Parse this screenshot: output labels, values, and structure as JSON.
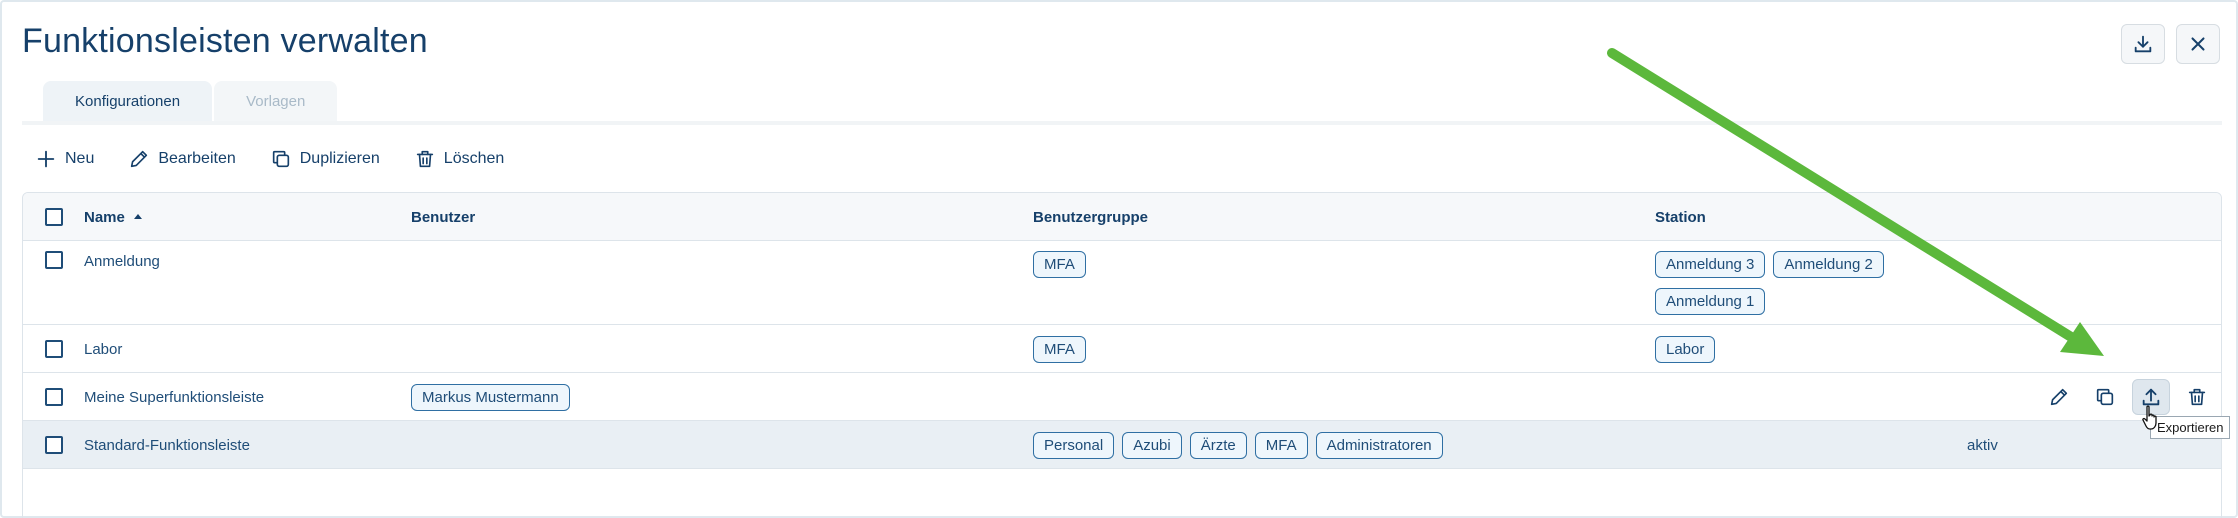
{
  "window": {
    "title": "Funktionsleisten verwalten"
  },
  "header_buttons": {
    "download_icon": "download-icon",
    "close_icon": "close-icon"
  },
  "tabs": [
    {
      "label": "Konfigurationen",
      "active": true
    },
    {
      "label": "Vorlagen",
      "active": false
    }
  ],
  "toolbar": {
    "new_label": "Neu",
    "edit_label": "Bearbeiten",
    "duplicate_label": "Duplizieren",
    "delete_label": "Löschen"
  },
  "table": {
    "columns": {
      "name": "Name",
      "user": "Benutzer",
      "group": "Benutzergruppe",
      "station": "Station"
    },
    "rows": [
      {
        "name": "Anmeldung",
        "user": [],
        "groups": [
          "MFA"
        ],
        "stations": [
          "Anmeldung 3",
          "Anmeldung 2",
          "Anmeldung 1"
        ],
        "status": ""
      },
      {
        "name": "Labor",
        "user": [],
        "groups": [
          "MFA"
        ],
        "stations": [
          "Labor"
        ],
        "status": ""
      },
      {
        "name": "Meine Superfunktionsleiste",
        "user": [
          "Markus Mustermann"
        ],
        "groups": [],
        "stations": [],
        "status": ""
      },
      {
        "name": "Standard-Funktionsleiste",
        "user": [],
        "groups": [
          "Personal",
          "Azubi",
          "Ärzte",
          "MFA",
          "Administratoren"
        ],
        "stations": [],
        "status": "aktiv"
      }
    ]
  },
  "tooltip": {
    "text": "Exportieren"
  },
  "colors": {
    "primary": "#16406a",
    "chip_border": "#2f6fa3",
    "arrow": "#5cb83c"
  }
}
